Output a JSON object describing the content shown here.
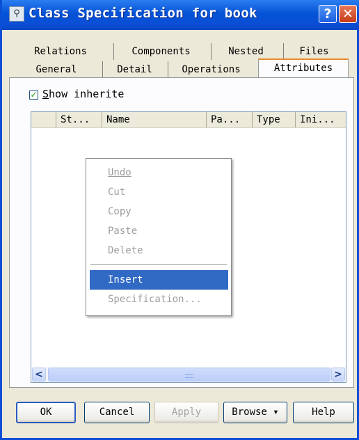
{
  "window": {
    "title": "Class Specification for book",
    "help_label": "?",
    "close_label": "✕",
    "app_icon": "class-spec-icon"
  },
  "tabs": {
    "row1": [
      "Relations",
      "Components",
      "Nested",
      "Files"
    ],
    "row2": [
      "General",
      "Detail",
      "Operations",
      "Attributes"
    ],
    "active": "Attributes"
  },
  "attributes": {
    "show_inherited_label": "Show inherite",
    "show_inherited_checked": true,
    "columns": [
      "",
      "St...",
      "Name",
      "Pa...",
      "Type",
      "Ini..."
    ]
  },
  "context_menu": {
    "items": [
      {
        "label": "Undo",
        "enabled": false
      },
      {
        "label": "Cut",
        "enabled": false
      },
      {
        "label": "Copy",
        "enabled": false
      },
      {
        "label": "Paste",
        "enabled": false
      },
      {
        "label": "Delete",
        "enabled": false
      },
      {
        "label": "Insert",
        "enabled": true,
        "highlighted": true
      },
      {
        "label": "Specification...",
        "enabled": false
      }
    ]
  },
  "scrollbar": {
    "left_icon": "<",
    "right_icon": ">"
  },
  "buttons": {
    "ok": "OK",
    "cancel": "Cancel",
    "apply": "Apply",
    "browse": "Browse ▾",
    "help": "Help"
  },
  "colors": {
    "title_bar": "#0a4fd6",
    "highlight": "#316ac5",
    "active_tab_accent": "#e68b2c"
  }
}
